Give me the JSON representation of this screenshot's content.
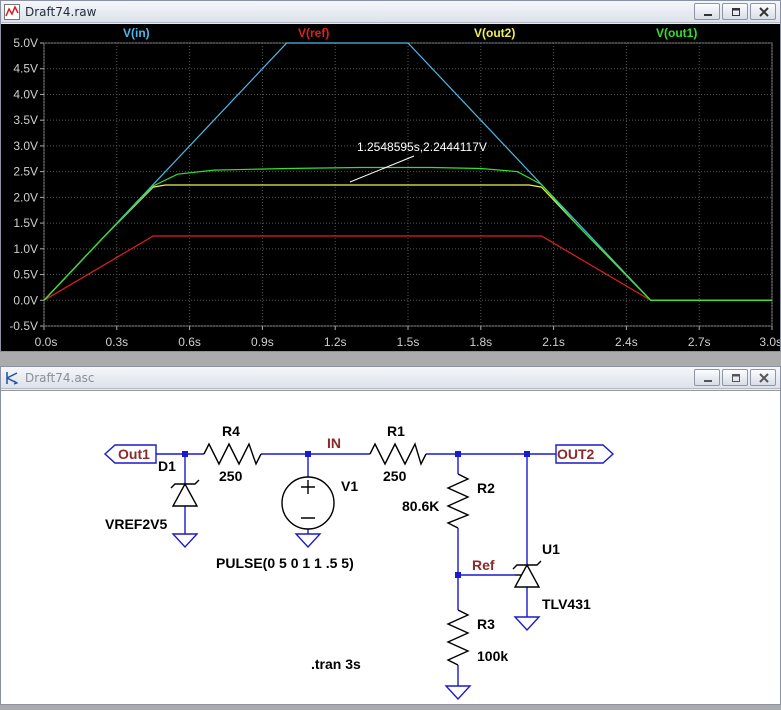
{
  "wave_window": {
    "title": "Draft74.raw",
    "traces": [
      {
        "name": "V(in)",
        "color": "#4fb8e8"
      },
      {
        "name": "V(ref)",
        "color": "#e02020"
      },
      {
        "name": "V(out2)",
        "color": "#f0f050"
      },
      {
        "name": "V(out1)",
        "color": "#30e030"
      }
    ],
    "y_ticks": [
      "5.0V",
      "4.5V",
      "4.0V",
      "3.5V",
      "3.0V",
      "2.5V",
      "2.0V",
      "1.5V",
      "1.0V",
      "0.5V",
      "0.0V",
      "-0.5V"
    ],
    "x_ticks": [
      "0.0s",
      "0.3s",
      "0.6s",
      "0.9s",
      "1.2s",
      "1.5s",
      "1.8s",
      "2.1s",
      "2.4s",
      "2.7s",
      "3.0s"
    ],
    "cursor_label": "1.2548595s,2.2444117V"
  },
  "chart_data": {
    "type": "line",
    "xlabel": "",
    "ylabel": "",
    "xlim": [
      0,
      3.0
    ],
    "ylim": [
      -0.5,
      5.0
    ],
    "grid": true,
    "legend": "top",
    "series": [
      {
        "name": "V(in)",
        "color": "#4fb8e8",
        "x": [
          0,
          1.0,
          1.5,
          2.5,
          3.0
        ],
        "y": [
          0,
          5.0,
          5.0,
          0,
          0
        ]
      },
      {
        "name": "V(ref)",
        "color": "#e02020",
        "x": [
          0,
          0.45,
          0.6,
          1.0,
          1.5,
          1.9,
          2.05,
          2.5,
          3.0
        ],
        "y": [
          0,
          1.25,
          1.25,
          1.25,
          1.25,
          1.25,
          1.25,
          0,
          0
        ]
      },
      {
        "name": "V(out2)",
        "color": "#f0f050",
        "x": [
          0,
          0.25,
          0.45,
          0.5,
          1.0,
          1.5,
          2.0,
          2.05,
          2.2,
          2.5,
          3.0
        ],
        "y": [
          0,
          1.25,
          2.2,
          2.24,
          2.24,
          2.24,
          2.24,
          2.2,
          1.45,
          0,
          0
        ]
      },
      {
        "name": "V(out1)",
        "color": "#30e030",
        "x": [
          0,
          0.25,
          0.45,
          0.55,
          0.7,
          1.0,
          1.3,
          1.6,
          1.8,
          1.95,
          2.05,
          2.2,
          2.5,
          3.0
        ],
        "y": [
          0,
          1.25,
          2.22,
          2.45,
          2.53,
          2.56,
          2.58,
          2.58,
          2.56,
          2.5,
          2.25,
          1.45,
          0,
          0
        ]
      }
    ],
    "annotations": [
      "1.2548595s,2.2444117V"
    ]
  },
  "schematic_window": {
    "title": "Draft74.asc",
    "ports": {
      "out1": "Out1",
      "out2": "OUT2"
    },
    "nets": {
      "in": "IN",
      "ref": "Ref"
    },
    "components": {
      "r4_name": "R4",
      "r4_value": "250",
      "r1_name": "R1",
      "r1_value": "250",
      "r2_name": "R2",
      "r2_value": "80.6K",
      "r3_name": "R3",
      "r3_value": "100k",
      "d1_name": "D1",
      "d1_value": "VREF2V5",
      "v1_name": "V1",
      "v1_value": "PULSE(0 5 0 1 1 .5 5)",
      "u1_name": "U1",
      "u1_value": "TLV431"
    },
    "directive": ".tran 3s"
  }
}
